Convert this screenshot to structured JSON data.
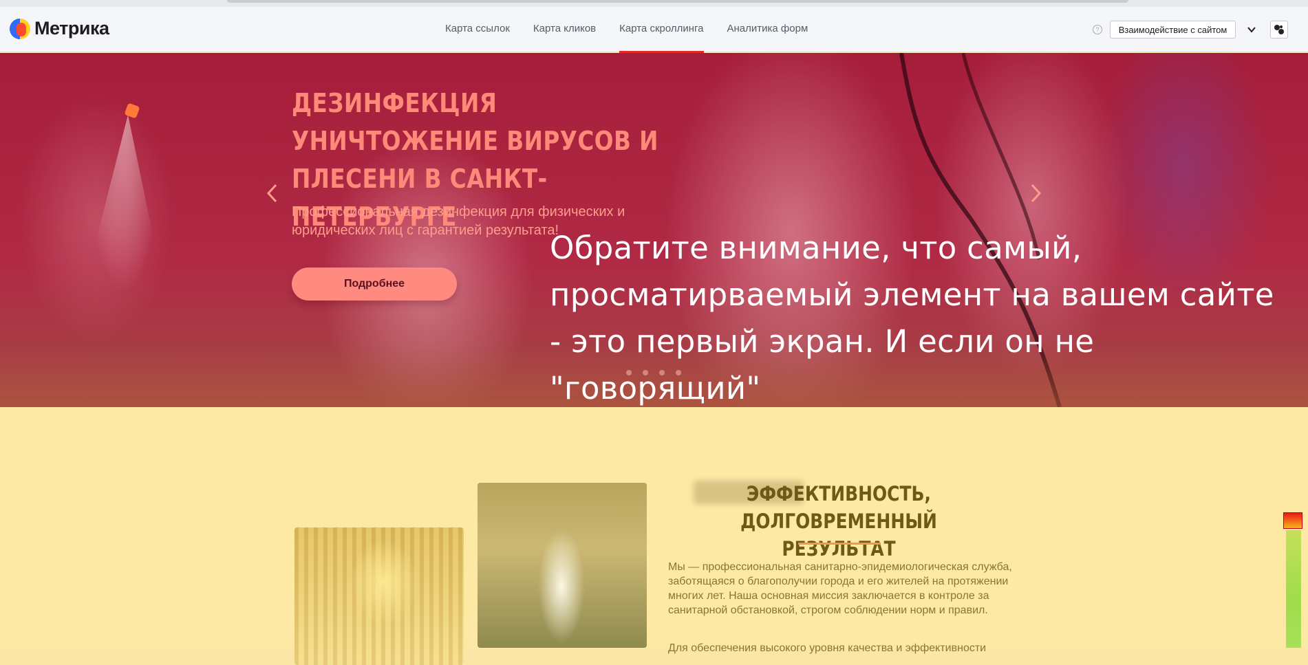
{
  "app": {
    "logo_text": "Метрика",
    "nav": [
      {
        "label": "Карта ссылок"
      },
      {
        "label": "Карта кликов"
      },
      {
        "label": "Карта скроллинга",
        "active": true
      },
      {
        "label": "Аналитика форм"
      }
    ],
    "help_icon": "?",
    "interaction_button": "Взаимодействие с сайтом",
    "icons": [
      "help-icon",
      "chevron-down-icon",
      "heatmap-toggle-icon"
    ],
    "colors": {
      "active_tab_underline": "#e22b2b",
      "hero_heat": "#a51d3a",
      "lower_heat": "#fde8a4"
    }
  },
  "hero": {
    "title_lines": [
      "ДЕЗИНФЕКЦИЯ",
      "УНИЧТОЖЕНИЕ ВИРУСОВ И",
      "ПЛЕСЕНИ В САНКТ-ПЕТЕРБУРГЕ"
    ],
    "subtitle": "Профессиональная дезинфекция для физических и юридических лиц с гарантией результата!",
    "cta": "Подробнее",
    "prev_icon": "chevron-left-icon",
    "next_icon": "chevron-right-icon"
  },
  "annotation": {
    "text": "Обратите внимание, что самый,\n просматирваемый элемент на вашем сайте\n- это первый экран. И если он не \"говорящий\"\nто вы теряете конверсию сразу!"
  },
  "about": {
    "title": "ЭФФЕКТИВНОСТЬ, ДОЛГОВРЕМЕННЫЙ РЕЗУЛЬТАТ",
    "paragraph": "Мы — профессиональная санитарно-эпидемиологическая служба, заботящаяся о благополучии города и его жителей на протяжении многих лет. Наша основная миссия заключается в контроле за санитарной обстановкой, строгом соблюдении норм и правил.",
    "paragraph_2_partial": "Для обеспечения высокого уровня качества и эффективности"
  }
}
